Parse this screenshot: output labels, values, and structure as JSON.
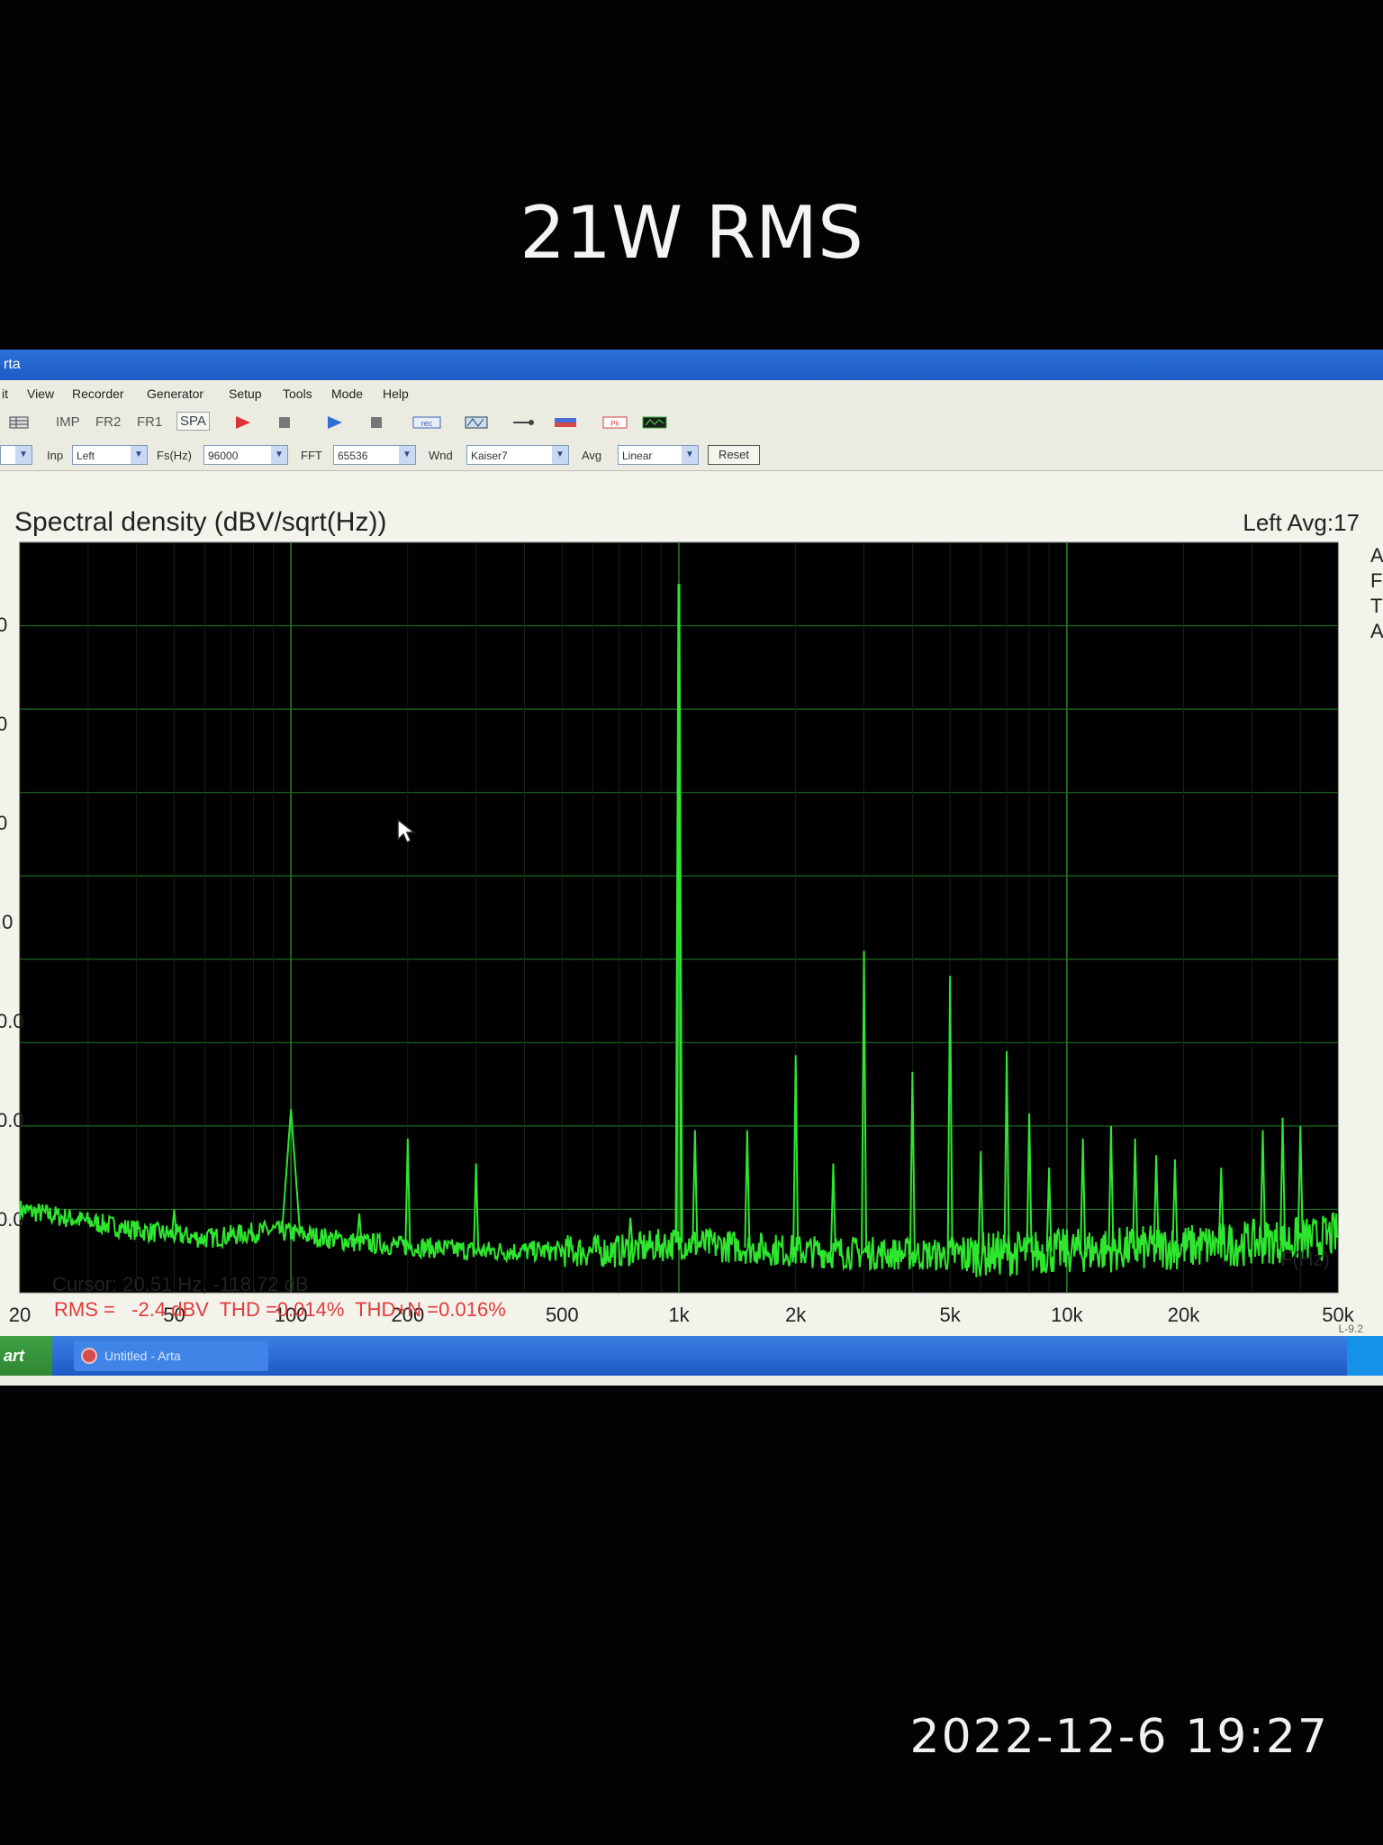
{
  "overlay": {
    "caption": "21W RMS",
    "timestamp": "2022-12-6 19:27"
  },
  "window": {
    "title": "rta"
  },
  "menu": [
    "it",
    "View",
    "Recorder",
    "Generator",
    "Setup",
    "Tools",
    "Mode",
    "Help"
  ],
  "toolbar": {
    "modes": [
      "IMP",
      "FR2",
      "FR1",
      "SPA"
    ],
    "active_mode": "SPA"
  },
  "controls": {
    "inp_label": "Inp",
    "inp_value": "Left",
    "fs_label": "Fs(Hz)",
    "fs_value": "96000",
    "fft_label": "FFT",
    "fft_value": "65536",
    "wnd_label": "Wnd",
    "wnd_value": "Kaiser7",
    "avg_label": "Avg",
    "avg_value": "Linear",
    "reset_label": "Reset"
  },
  "plot": {
    "title": "Spectral density (dBV/sqrt(Hz))",
    "channel_info": "Left  Avg:17",
    "side_letters": [
      "A",
      "F",
      "T",
      "A"
    ],
    "y_tick_labels": [
      "0",
      "0",
      "0",
      ".0",
      "0.0",
      "0.0",
      "0.0"
    ],
    "x_axis_label": "F(Hz)",
    "cursor_readout": "Cursor: 20.51 Hz, -118.72 dB",
    "results": "RMS =   -2.4 dBV  THD =0.014%  THD+N =0.016%",
    "version": "L-9.2"
  },
  "chart_data": {
    "type": "line",
    "title": "Spectral density (dBV/sqrt(Hz))",
    "xlabel": "F(Hz)",
    "ylabel": "",
    "x_scale": "log",
    "xlim": [
      20,
      50000
    ],
    "ylim": [
      -170,
      10
    ],
    "x_ticks": [
      20,
      50,
      100,
      200,
      500,
      1000,
      2000,
      5000,
      10000,
      20000,
      50000
    ],
    "x_tick_labels": [
      "20",
      "50",
      "100",
      "200",
      "500",
      "1k",
      "2k",
      "5k",
      "10k",
      "20k",
      "50k"
    ],
    "grid": true,
    "series": [
      {
        "color": "#2fe62f",
        "noise_floor": [
          [
            20,
            -150
          ],
          [
            40,
            -155
          ],
          [
            60,
            -157
          ],
          [
            90,
            -155
          ],
          [
            150,
            -158
          ],
          [
            300,
            -160
          ],
          [
            700,
            -160
          ],
          [
            1000,
            -158
          ],
          [
            2000,
            -160
          ],
          [
            5000,
            -161
          ],
          [
            10000,
            -160
          ],
          [
            20000,
            -159
          ],
          [
            45000,
            -157
          ],
          [
            50000,
            -156
          ]
        ],
        "peaks": [
          {
            "f": 50,
            "db": -150
          },
          {
            "f": 100,
            "db": -126
          },
          {
            "f": 150,
            "db": -151
          },
          {
            "f": 200,
            "db": -133
          },
          {
            "f": 300,
            "db": -139
          },
          {
            "f": 750,
            "db": -152
          },
          {
            "f": 1000,
            "db": 0
          },
          {
            "f": 1100,
            "db": -131
          },
          {
            "f": 1500,
            "db": -131
          },
          {
            "f": 2000,
            "db": -113
          },
          {
            "f": 2500,
            "db": -139
          },
          {
            "f": 3000,
            "db": -88
          },
          {
            "f": 4000,
            "db": -117
          },
          {
            "f": 5000,
            "db": -94
          },
          {
            "f": 6000,
            "db": -136
          },
          {
            "f": 7000,
            "db": -112
          },
          {
            "f": 8000,
            "db": -127
          },
          {
            "f": 9000,
            "db": -140
          },
          {
            "f": 11000,
            "db": -133
          },
          {
            "f": 13000,
            "db": -130
          },
          {
            "f": 15000,
            "db": -133
          },
          {
            "f": 17000,
            "db": -137
          },
          {
            "f": 19000,
            "db": -138
          },
          {
            "f": 25000,
            "db": -140
          },
          {
            "f": 32000,
            "db": -131
          },
          {
            "f": 36000,
            "db": -128
          },
          {
            "f": 40000,
            "db": -130
          }
        ]
      }
    ]
  }
}
